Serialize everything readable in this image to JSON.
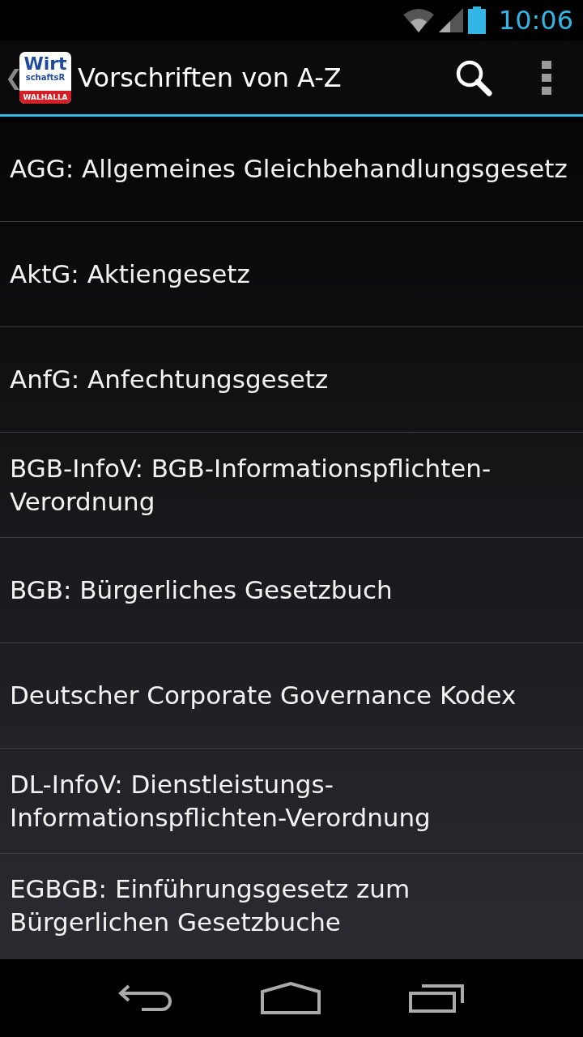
{
  "status_bar": {
    "time": "10:06"
  },
  "action_bar": {
    "back": "❮",
    "logo": {
      "line_1": "Wirt",
      "line_2": "schaftsR",
      "line_3": "WALHALLA"
    },
    "title": "Vorschriften von A-Z"
  },
  "list": [
    {
      "label": "AGG: Allgemeines Gleichbehandlungsgesetz"
    },
    {
      "label": "AktG: Aktiengesetz"
    },
    {
      "label": "AnfG: Anfechtungsgesetz"
    },
    {
      "label": "BGB-InfoV: BGB-Informationspflichten-Verordnung"
    },
    {
      "label": "BGB: Bürgerliches Gesetzbuch"
    },
    {
      "label": "Deutscher Corporate Governance Kodex"
    },
    {
      "label": "DL-InfoV: Dienstleistungs-Informationspflichten-Verordnung"
    },
    {
      "label": "EGBGB: Einführungsgesetz zum Bürgerlichen Gesetzbuche"
    }
  ]
}
